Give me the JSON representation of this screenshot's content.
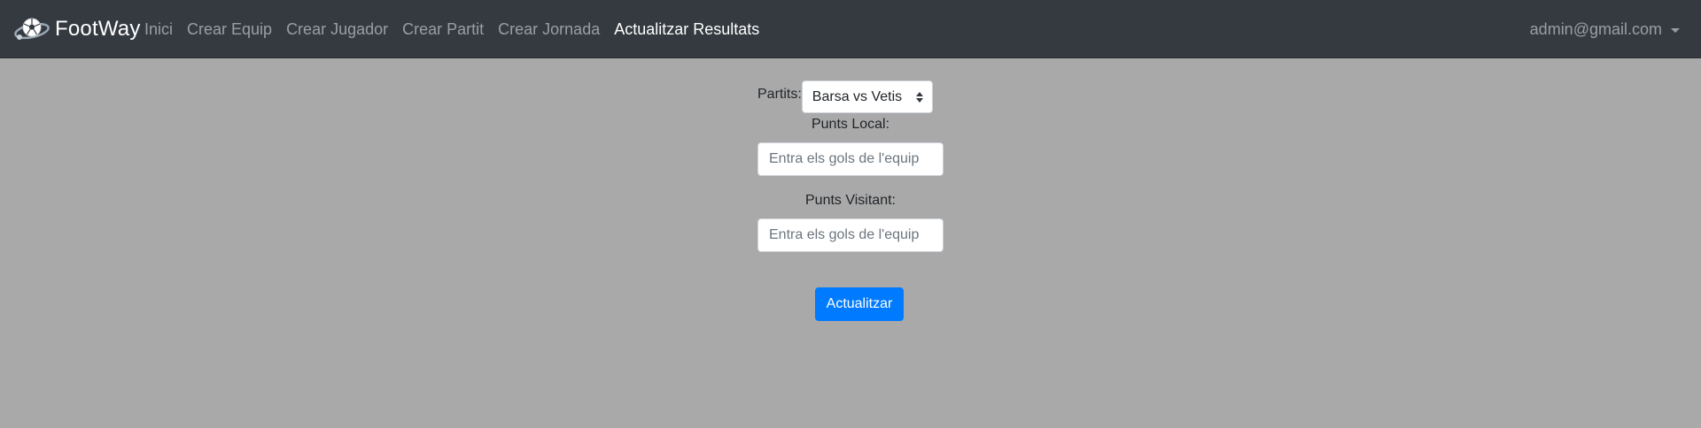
{
  "navbar": {
    "brand": "FootWay",
    "links": [
      {
        "label": "Inici",
        "active": false
      },
      {
        "label": "Crear Equip",
        "active": false
      },
      {
        "label": "Crear Jugador",
        "active": false
      },
      {
        "label": "Crear Partit",
        "active": false
      },
      {
        "label": "Crear Jornada",
        "active": false
      },
      {
        "label": "Actualitzar Resultats",
        "active": true
      }
    ],
    "user_email": "admin@gmail.com"
  },
  "form": {
    "partits_label": "Partits:",
    "partits_selected": "Barsa vs Vetis",
    "local_label": "Punts Local:",
    "local_placeholder": "Entra els gols de l'equip",
    "local_value": "",
    "visit_label": "Punts Visitant:",
    "visit_placeholder": "Entra els gols de l'equip",
    "visit_value": "",
    "submit_label": "Actualitzar"
  },
  "colors": {
    "navbar_bg": "#343a40",
    "page_bg": "#a9a9a9",
    "primary": "#007bff"
  }
}
